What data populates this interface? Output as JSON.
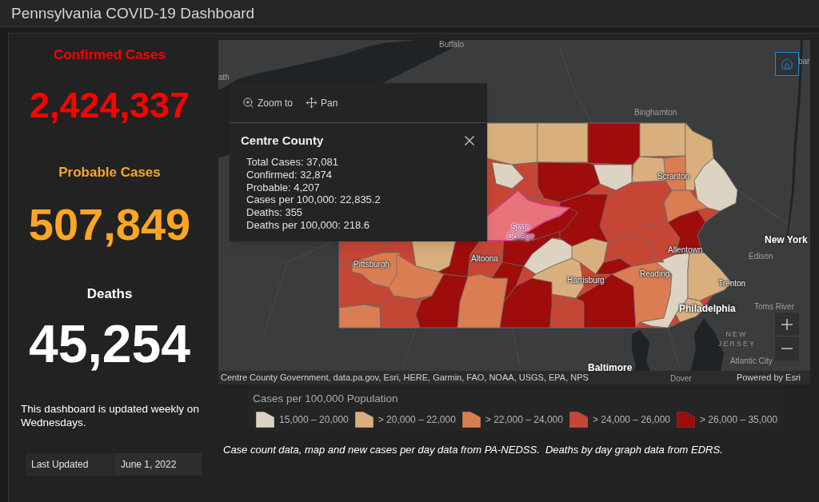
{
  "title": "Pennsylvania COVID-19 Dashboard",
  "stats": [
    {
      "label": "Confirmed Cases",
      "value": "2,424,337",
      "color": "#ff0000"
    },
    {
      "label": "Probable Cases",
      "value": "507,849",
      "color": "#fca624"
    },
    {
      "label": "Deaths",
      "value": "45,254",
      "color": "#ffffff"
    }
  ],
  "update_note": "This dashboard is updated weekly on Wednesdays.",
  "last_updated": {
    "label": "Last Updated",
    "value": "June 1, 2022"
  },
  "map": {
    "place_labels": [
      {
        "text": "Buffalo",
        "kind": "faint"
      },
      {
        "text": "ath",
        "kind": "faint"
      },
      {
        "text": "bar",
        "kind": "faint"
      },
      {
        "text": "Binghamton",
        "kind": "faint"
      },
      {
        "text": "Scranton",
        "kind": "city"
      },
      {
        "text": "State College",
        "kind": "highlight"
      },
      {
        "text": "New York",
        "kind": "major"
      },
      {
        "text": "Pittsburgh",
        "kind": "city"
      },
      {
        "text": "Altoona",
        "kind": "city"
      },
      {
        "text": "Edison",
        "kind": "faint"
      },
      {
        "text": "Allentown",
        "kind": "city"
      },
      {
        "text": "Reading",
        "kind": "city"
      },
      {
        "text": "Harrisburg",
        "kind": "city"
      },
      {
        "text": "Trenton",
        "kind": "city"
      },
      {
        "text": "Philadelphia",
        "kind": "major"
      },
      {
        "text": "Toms River",
        "kind": "faint"
      },
      {
        "text": "NEW JERSEY",
        "kind": "region"
      },
      {
        "text": "Atlantic City",
        "kind": "faint"
      },
      {
        "text": "Baltimore",
        "kind": "major"
      },
      {
        "text": "Dover",
        "kind": "faint"
      }
    ],
    "popup": {
      "actions": [
        {
          "label": "Zoom to",
          "kind": "zoom"
        },
        {
          "label": "Pan",
          "kind": "pan"
        }
      ],
      "title": "Centre County",
      "lines": [
        "Total Cases: 37,081",
        "Confirmed: 32,874",
        "Probable: 4,207",
        "Cases per 100,000: 22,835.2",
        "Deaths: 355",
        "Deaths per 100,000: 218.6"
      ]
    },
    "attribution": "Centre County Government, data.pa.gov, Esri, HERE, Garmin, FAO, NOAA, USGS, EPA, NPS",
    "powered_by": "Powered by Esri"
  },
  "legend": {
    "title": "Cases per 100,000 Population",
    "items": [
      {
        "label": "15,000 – 20,000",
        "color": "#ddd3c3"
      },
      {
        "label": "> 20,000 – 22,000",
        "color": "#d9af7d"
      },
      {
        "label": "> 22,000 – 24,000",
        "color": "#db7d52"
      },
      {
        "label": "> 24,000 – 26,000",
        "color": "#c64636"
      },
      {
        "label": "> 26,000 – 35,000",
        "color": "#9f0c0c"
      }
    ]
  },
  "footnote": "Case count data, map and new cases per day data from PA-NEDSS.  Deaths by day graph data from EDRS."
}
